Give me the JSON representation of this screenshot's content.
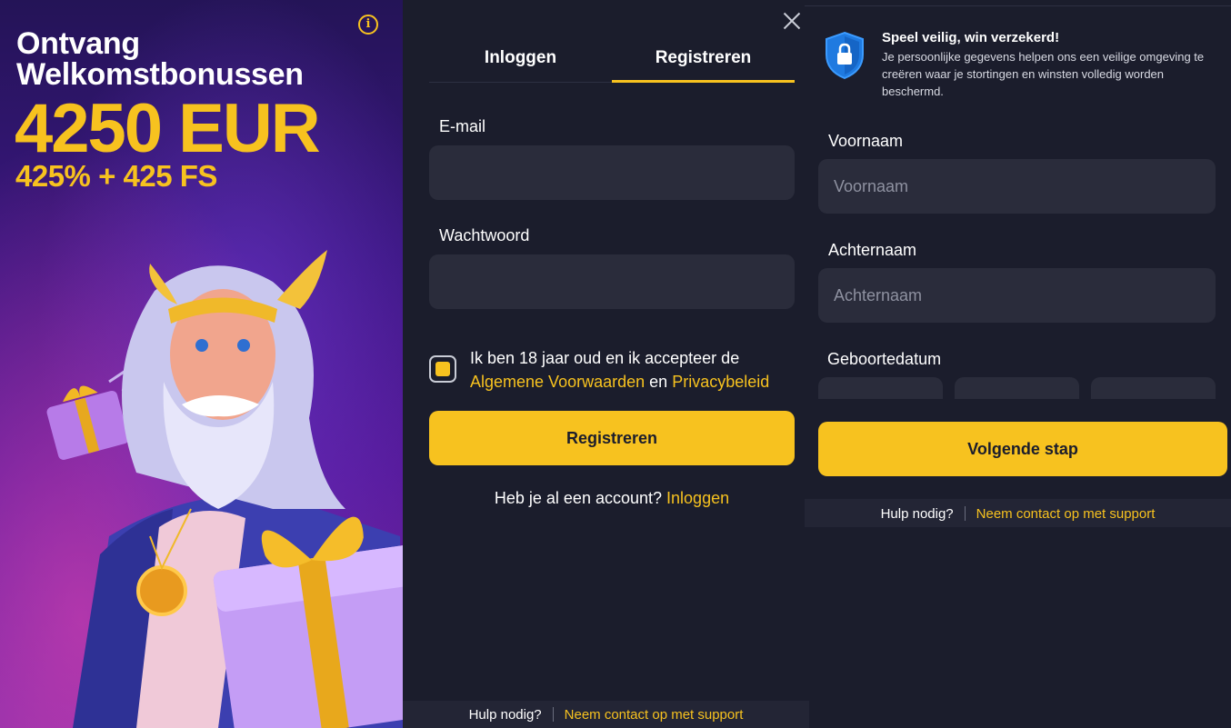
{
  "promo": {
    "line1": "Ontvang",
    "line2": "Welkomstbonussen",
    "amount": "4250 EUR",
    "extra": "425% + 425 FS",
    "info_icon": "info-icon",
    "accent_color": "#f7c21f"
  },
  "tabs": {
    "login": "Inloggen",
    "register": "Registreren",
    "active": "Registreren"
  },
  "form": {
    "email_label": "E-mail",
    "email_value": "",
    "password_label": "Wachtwoord",
    "password_value": "",
    "terms_prefix": "Ik ben 18 jaar oud en ik accepteer de",
    "terms_link": "Algemene Voorwaarden",
    "terms_and": "en",
    "privacy_link": "Privacybeleid",
    "submit": "Registreren",
    "have_account": "Heb je al een account?",
    "login_link": "Inloggen"
  },
  "help": {
    "question": "Hulp nodig?",
    "contact": "Neem contact op met support"
  },
  "security": {
    "title": "Speel veilig, win verzekerd!",
    "text": "Je persoonlijke gegevens helpen ons een veilige omgeving te creëren waar je stortingen en winsten volledig worden beschermd.",
    "icon": "shield-lock-icon"
  },
  "personal": {
    "first_name_label": "Voornaam",
    "first_name_placeholder": "Voornaam",
    "last_name_label": "Achternaam",
    "last_name_placeholder": "Achternaam",
    "birthdate_label": "Geboortedatum",
    "next_button": "Volgende stap"
  },
  "colors": {
    "background": "#1b1d2c",
    "field": "#2a2c3b",
    "accent": "#f7c21f"
  }
}
